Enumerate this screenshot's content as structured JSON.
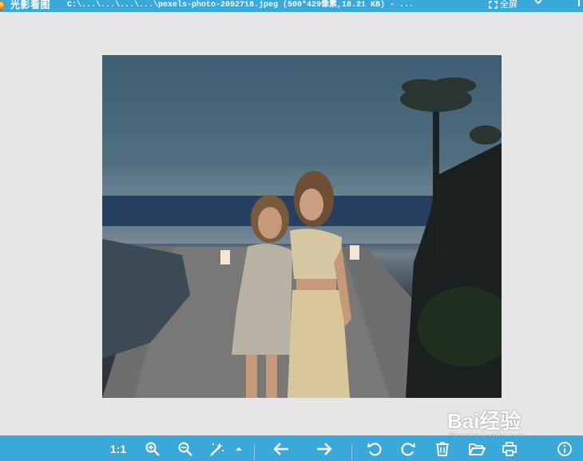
{
  "titlebar": {
    "app_name": "光影看图",
    "file_info": "C:\\...\\...\\...\\...\\pexels-photo-2092718.jpeg (500*429像素,18.21 KB) - ...",
    "fullscreen_label": "全屏"
  },
  "image": {
    "name": "pexels-photo-2092718.jpeg",
    "width": 500,
    "height": 429
  },
  "watermark": {
    "brand": "Bai经验",
    "url": "jingyan.baidu.com"
  },
  "toolbar": {
    "actual_size_label": "1:1",
    "icons": [
      "zoom-in-icon",
      "zoom-out-icon",
      "magic-wand-icon",
      "caret-up-icon",
      "arrow-left-icon",
      "arrow-right-icon",
      "rotate-ccw-icon",
      "rotate-cw-icon",
      "trash-icon",
      "folder-open-icon",
      "print-icon",
      "info-icon"
    ]
  },
  "colors": {
    "accent": "#3aa8d8",
    "background": "#e6e6e6"
  }
}
